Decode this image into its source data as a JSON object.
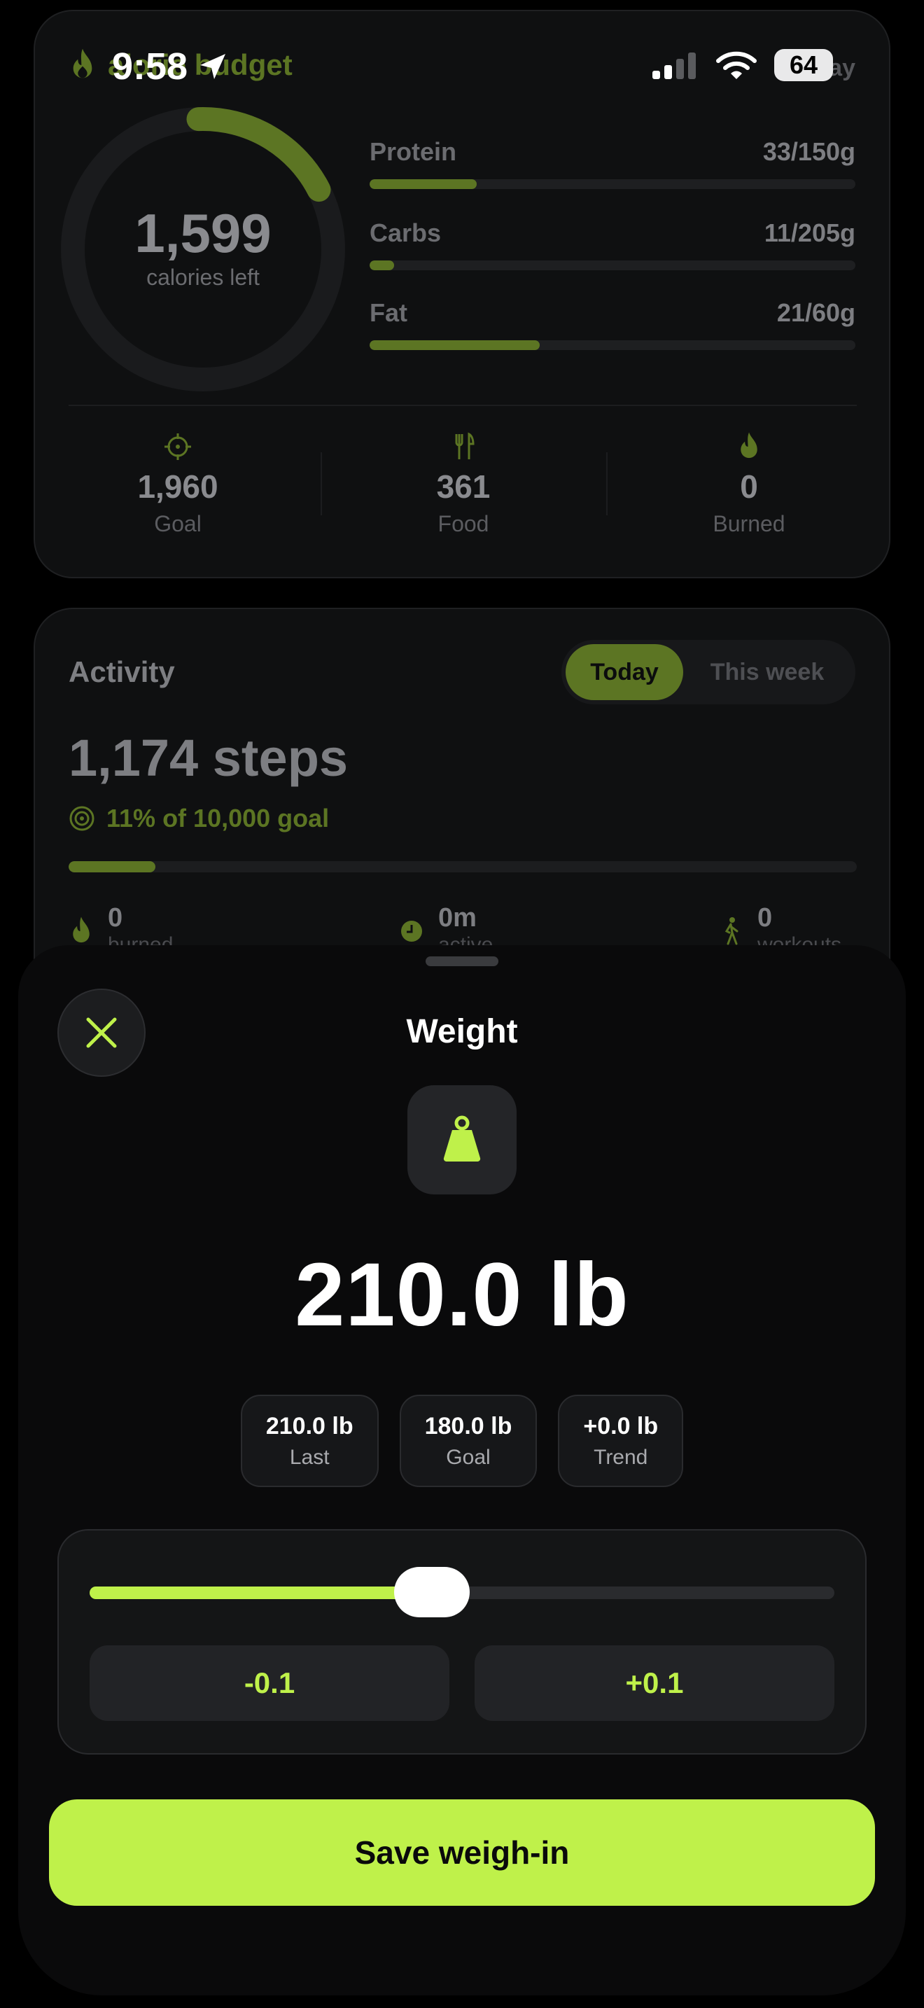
{
  "status_bar": {
    "time": "9:58",
    "battery": "64"
  },
  "budget_card": {
    "title": "alorie budget",
    "right_label": "day",
    "calories_left": "1,599",
    "calories_left_label": "calories left",
    "ring_progress": 0.18,
    "macros": [
      {
        "name": "Protein",
        "value": "33/150g",
        "progress": 0.22
      },
      {
        "name": "Carbs",
        "value": "11/205g",
        "progress": 0.05
      },
      {
        "name": "Fat",
        "value": "21/60g",
        "progress": 0.35
      }
    ],
    "stats": [
      {
        "value": "1,960",
        "label": "Goal",
        "icon": "target-icon"
      },
      {
        "value": "361",
        "label": "Food",
        "icon": "fork-knife-icon"
      },
      {
        "value": "0",
        "label": "Burned",
        "icon": "flame-icon"
      }
    ]
  },
  "activity_card": {
    "title": "Activity",
    "tabs": [
      {
        "label": "Today",
        "selected": true
      },
      {
        "label": "This week",
        "selected": false
      }
    ],
    "steps": "1,174 steps",
    "goal_text": "11% of 10,000 goal",
    "progress": 0.11,
    "mini_stats": [
      {
        "value": "0",
        "label": "burned",
        "icon": "flame-icon"
      },
      {
        "value": "0m",
        "label": "active",
        "icon": "clock-icon"
      },
      {
        "value": "0",
        "label": "workouts",
        "icon": "walking-icon"
      }
    ]
  },
  "sheet": {
    "title": "Weight",
    "weight": "210.0 lb",
    "chips": [
      {
        "value": "210.0 lb",
        "label": "Last"
      },
      {
        "value": "180.0 lb",
        "label": "Goal"
      },
      {
        "value": "+0.0 lb",
        "label": "Trend"
      }
    ],
    "slider_position": 0.46,
    "minus_label": "-0.1",
    "plus_label": "+0.1",
    "save_label": "Save weigh-in"
  },
  "colors": {
    "accent": "#bff14a",
    "accent_dim": "#5c7523",
    "background": "#000000",
    "surface": "#141516"
  }
}
